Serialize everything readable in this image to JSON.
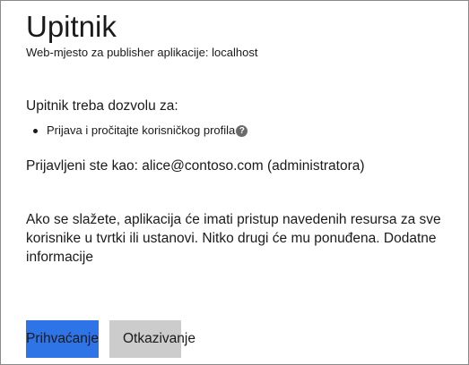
{
  "header": {
    "title": "Upitnik",
    "subtitle": "Web-mjesto za publisher aplikacije: localhost"
  },
  "permissions": {
    "heading": "Upitnik treba dozvolu za:",
    "items": [
      {
        "label": "Prijava i pročitajte korisničkog profila",
        "help_icon": "question-circle-icon",
        "help_glyph": "?"
      }
    ]
  },
  "account": {
    "signed_in_text": "Prijavljeni ste kao: alice@contoso.com (administratora)"
  },
  "consent": {
    "text": "Ako se slažete, aplikacija će imati pristup navedenih resursa za sve korisnike u tvrtki ili ustanovi. Nitko drugi će mu ponuđena.",
    "link": "Dodatne informacije"
  },
  "actions": {
    "accept_label": "Prihvaćanje",
    "cancel_label": "Otkazivanje"
  },
  "colors": {
    "accept_button": "#2f74e6",
    "cancel_button": "#cccccc",
    "help_icon": "#6b6b6b",
    "border": "#8a8a8a"
  }
}
